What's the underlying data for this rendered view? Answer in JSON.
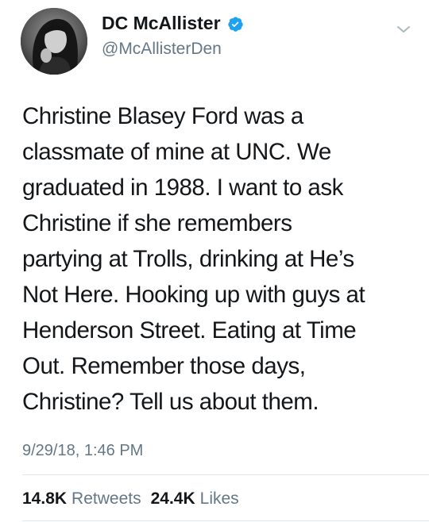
{
  "author": {
    "display_name": "DC McAllister",
    "handle": "@McAllisterDen",
    "verified": true,
    "verified_color": "#1da1f2"
  },
  "tweet": {
    "lines": [
      "Christine Blasey Ford was a",
      "classmate of mine at UNC. We",
      "graduated in 1988. I want to ask",
      "Christine if she remembers",
      "partying at Trolls, drinking at He’s",
      "Not Here. Hooking up with guys at",
      "Henderson Street. Eating at Time",
      "Out. Remember those days,",
      "Christine? Tell us about them."
    ],
    "timestamp": "9/29/18, 1:46 PM"
  },
  "stats": {
    "retweets_count": "14.8K",
    "retweets_label": "Retweets",
    "likes_count": "24.4K",
    "likes_label": "Likes"
  },
  "icons": {
    "avatar": "avatar-photo",
    "verified": "verified-badge-icon",
    "menu": "chevron-down-icon"
  },
  "colors": {
    "text": "#14171a",
    "secondary_text": "#657786",
    "divider": "#e1e8ed"
  }
}
